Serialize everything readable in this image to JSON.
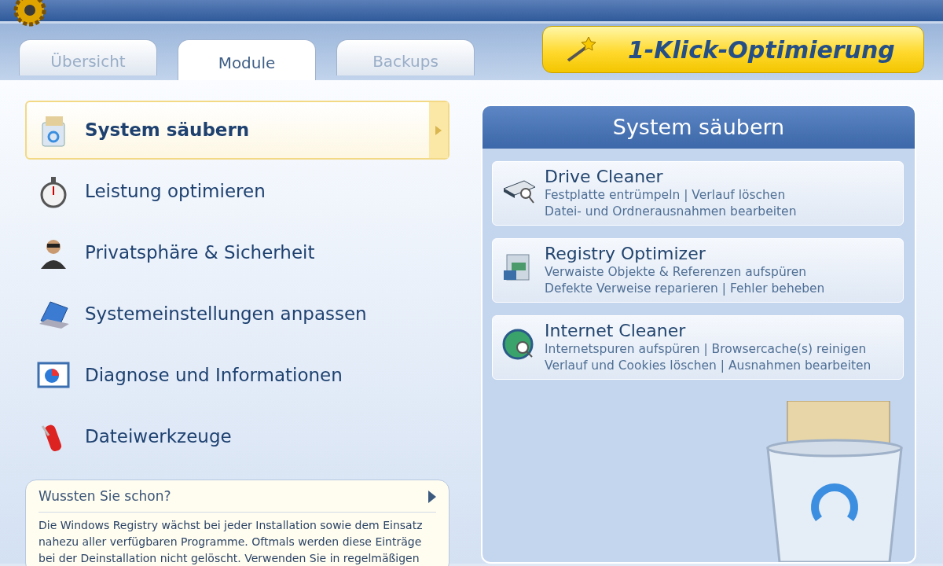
{
  "tabs": [
    {
      "label": "Übersicht",
      "selected": false
    },
    {
      "label": "Module",
      "selected": true
    },
    {
      "label": "Backups",
      "selected": false
    }
  ],
  "one_click_button": {
    "label": "1-Klick-Optimierung"
  },
  "modules": [
    {
      "label": "System säubern",
      "selected": true
    },
    {
      "label": "Leistung optimieren",
      "selected": false
    },
    {
      "label": "Privatsphäre & Sicherheit",
      "selected": false
    },
    {
      "label": "Systemeinstellungen anpassen",
      "selected": false
    },
    {
      "label": "Diagnose und Informationen",
      "selected": false
    },
    {
      "label": "Dateiwerkzeuge",
      "selected": false
    }
  ],
  "tip": {
    "title": "Wussten Sie schon?",
    "text": "Die Windows Registry wächst bei jeder Installation sowie dem Einsatz nahezu aller verfügbaren Programme. Oftmals werden diese Einträge bei der Deinstallation nicht gelöscht. Verwenden Sie in regelmäßigen"
  },
  "panel": {
    "title": "System säubern",
    "tools": [
      {
        "name": "Drive Cleaner",
        "lines": [
          "Festplatte entrümpeln | Verlauf löschen",
          "Datei- und Ordnerausnahmen bearbeiten"
        ]
      },
      {
        "name": "Registry Optimizer",
        "lines": [
          "Verwaiste Objekte & Referenzen aufspüren",
          "Defekte Verweise reparieren | Fehler beheben"
        ]
      },
      {
        "name": "Internet Cleaner",
        "lines": [
          "Internetspuren aufspüren | Browsercache(s) reinigen",
          "Verlauf und Cookies löschen | Ausnahmen bearbeiten"
        ]
      }
    ]
  }
}
